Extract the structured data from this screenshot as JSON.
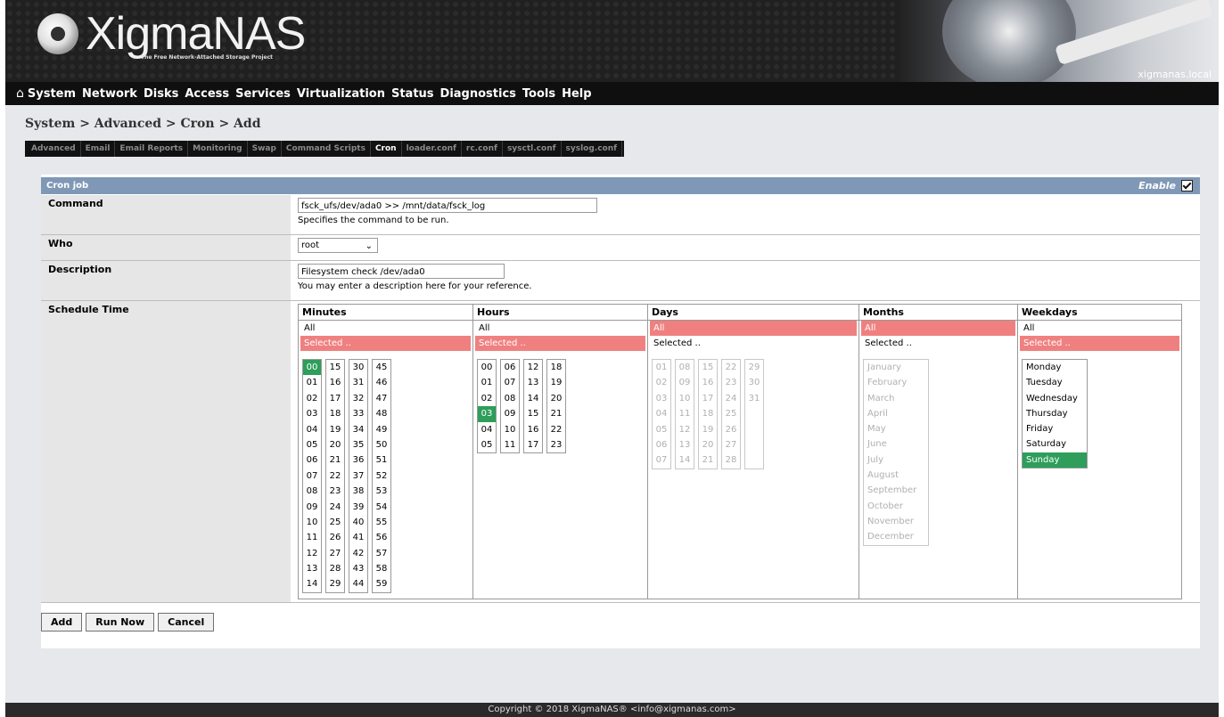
{
  "header": {
    "logo_text": "XigmaNAS",
    "logo_subtitle": "The Free Network-Attached Storage Project",
    "hostname": "xigmanas.local"
  },
  "nav": {
    "items": [
      "System",
      "Network",
      "Disks",
      "Access",
      "Services",
      "Virtualization",
      "Status",
      "Diagnostics",
      "Tools",
      "Help"
    ]
  },
  "breadcrumb": "System > Advanced > Cron > Add",
  "tabs": [
    "Advanced",
    "Email",
    "Email Reports",
    "Monitoring",
    "Swap",
    "Command Scripts",
    "Cron",
    "loader.conf",
    "rc.conf",
    "sysctl.conf",
    "syslog.conf"
  ],
  "active_tab": "Cron",
  "panel": {
    "title": "Cron job",
    "enable_label": "Enable",
    "enabled": true
  },
  "command": {
    "label": "Command",
    "value": "fsck_ufs/dev/ada0 >> /mnt/data/fsck_log",
    "hint": "Specifies the command to be run."
  },
  "who": {
    "label": "Who",
    "value": "root"
  },
  "description": {
    "label": "Description",
    "value": "Filesystem check /dev/ada0",
    "hint": "You may enter a description here for your reference."
  },
  "schedule": {
    "label": "Schedule Time",
    "all_label": "All",
    "selected_label": "Selected ..",
    "minutes": {
      "title": "Minutes",
      "mode": "Selected ..",
      "selected": [
        "00"
      ]
    },
    "hours": {
      "title": "Hours",
      "mode": "Selected ..",
      "selected": [
        "03"
      ]
    },
    "days": {
      "title": "Days",
      "mode": "All"
    },
    "months": {
      "title": "Months",
      "mode": "All",
      "list": [
        "January",
        "February",
        "March",
        "April",
        "May",
        "June",
        "July",
        "August",
        "September",
        "October",
        "November",
        "December"
      ]
    },
    "weekdays": {
      "title": "Weekdays",
      "mode": "Selected ..",
      "list": [
        "Monday",
        "Tuesday",
        "Wednesday",
        "Thursday",
        "Friday",
        "Saturday",
        "Sunday"
      ],
      "selected": [
        "Sunday"
      ]
    }
  },
  "buttons": {
    "add": "Add",
    "run_now": "Run Now",
    "cancel": "Cancel"
  },
  "footer": "Copyright © 2018 XigmaNAS® <info@xigmanas.com>",
  "colors": {
    "selected_mode": "#f08080",
    "selected_item": "#2e9e5a",
    "title_bar": "#7f98b6"
  }
}
